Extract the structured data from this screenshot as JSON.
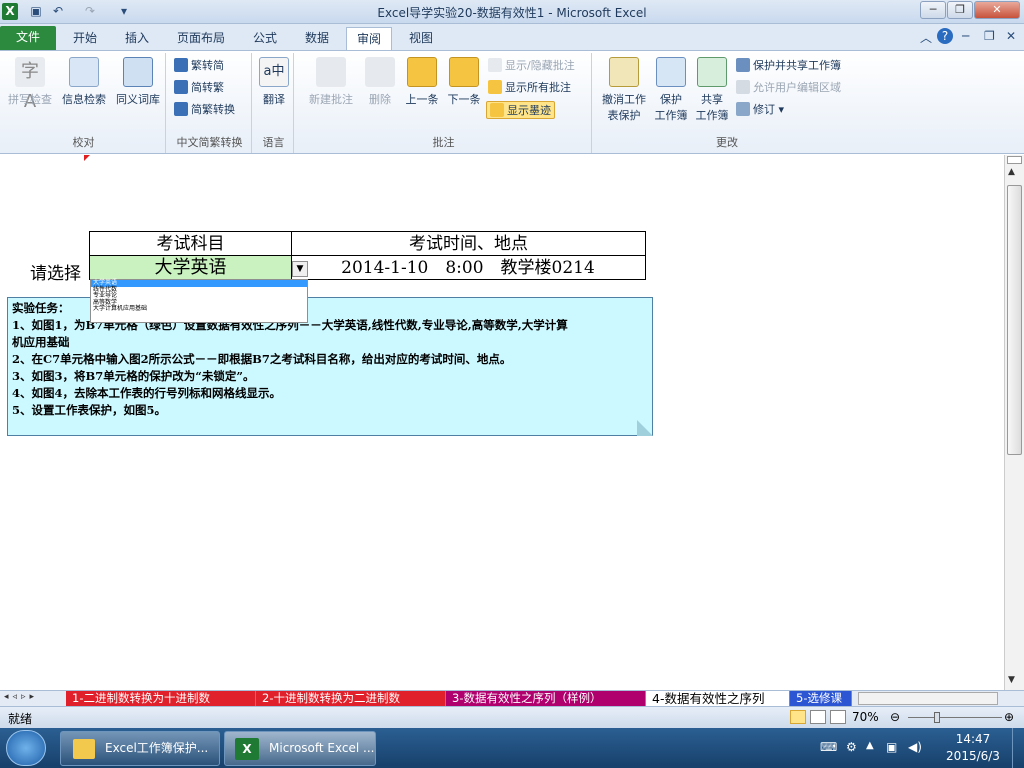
{
  "window": {
    "title": "Excel导学实验20-数据有效性1 - Microsoft Excel"
  },
  "tabs": [
    {
      "label": "文件"
    },
    {
      "label": "开始"
    },
    {
      "label": "插入"
    },
    {
      "label": "页面布局"
    },
    {
      "label": "公式"
    },
    {
      "label": "数据"
    },
    {
      "label": "审阅"
    },
    {
      "label": "视图"
    }
  ],
  "ribbon": {
    "proofing": {
      "label": "校对",
      "spell": "拼写检查",
      "research": "信息检索",
      "thesaurus": "同义词库"
    },
    "chinese": {
      "label": "中文简繁转换",
      "to_simplified": "繁转简",
      "to_traditional": "简转繁",
      "convert": "简繁转换"
    },
    "language": {
      "label": "语言",
      "translate": "翻译"
    },
    "comments": {
      "label": "批注",
      "new": "新建批注",
      "delete": "删除",
      "prev": "上一条",
      "next": "下一条",
      "show_hide": "显示/隐藏批注",
      "show_all": "显示所有批注",
      "show_ink": "显示墨迹"
    },
    "changes": {
      "label": "更改",
      "unprotect_sheet_1": "撤消工作",
      "unprotect_sheet_2": "表保护",
      "protect_wb_1": "保护",
      "protect_wb_2": "工作簿",
      "share_wb_1": "共享",
      "share_wb_2": "工作簿",
      "protect_share": "保护并共享工作簿",
      "allow_edit": "允许用户编辑区域",
      "track": "修订"
    }
  },
  "sheet": {
    "header_subject": "考试科目",
    "header_time": "考试时间、地点",
    "prompt": "请选择",
    "selected_subject": "大学英语",
    "time_place": "2014-1-10　8:00　教学楼0214",
    "dropdown_options": [
      "大学英语",
      "线性代数",
      "专业导论",
      "高等数学",
      "大学计算机应用基础"
    ],
    "task_lines": [
      "实验任务：",
      "1、如图1，为B7单元格（绿色）设置数据有效性之序列－－大学英语,线性代数,专业导论,高等数学,大学计算",
      "机应用基础",
      "2、在C7单元格中输入图2所示公式－－即根据B7之考试科目名称，给出对应的考试时间、地点。",
      "3、如图3，将B7单元格的保护改为“未锁定”。",
      "4、如图4，去除本工作表的行号列标和网格线显示。",
      "5、设置工作表保护，如图5。"
    ]
  },
  "sheet_tabs": [
    {
      "label": "1-二进制数转换为十进制数",
      "color": "#e0202a"
    },
    {
      "label": "2-十进制数转换为二进制数",
      "color": "#e0202a"
    },
    {
      "label": "3-数据有效性之序列（样例）",
      "color": "#b0006e"
    },
    {
      "label": "4-数据有效性之序列",
      "color": "#ffffff"
    },
    {
      "label": "5-选修课",
      "color": "#2c55d4"
    }
  ],
  "status": {
    "ready": "就绪",
    "zoom": "70%"
  },
  "taskbar": {
    "item1": "Excel工作簿保护...",
    "item2": "Microsoft Excel ...",
    "time": "14:47",
    "date": "2015/6/3"
  }
}
